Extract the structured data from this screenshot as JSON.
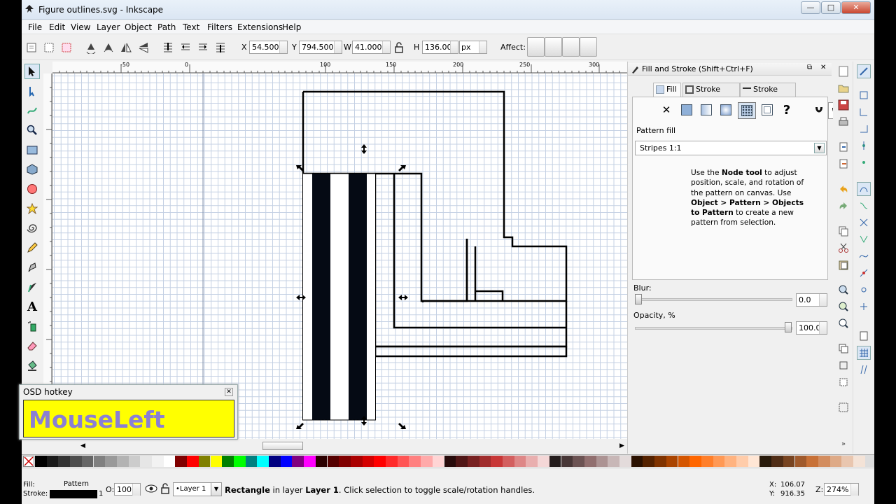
{
  "window": {
    "title": "Figure outlines.svg - Inkscape",
    "min": "—",
    "max": "□",
    "close": "✕"
  },
  "menu": [
    "File",
    "Edit",
    "View",
    "Layer",
    "Object",
    "Path",
    "Text",
    "Filters",
    "Extensions",
    "Help"
  ],
  "toolctrl": {
    "x_label": "X",
    "x_value": "54.500",
    "y_label": "Y",
    "y_value": "794.500",
    "w_label": "W",
    "w_value": "41.000",
    "h_label": "H",
    "h_value": "136.000",
    "unit": "px",
    "affect_label": "Affect:"
  },
  "ruler": {
    "top_ticks": [
      "-50",
      "0",
      "100",
      "150",
      "200",
      "250",
      "300"
    ]
  },
  "dock": {
    "title": "Fill and Stroke (Shift+Ctrl+F)",
    "tabs": [
      "Fill",
      "Stroke paint",
      "Stroke style"
    ],
    "section_label": "Pattern fill",
    "pattern_value": "Stripes 1:1",
    "help_html": "Use the <b>Node tool</b> to adjust position, scale, and rotation of the pattern on canvas. Use <b>Object &gt; Pattern &gt; Objects to Pattern</b> to create a new pattern from selection.",
    "blur_label": "Blur:",
    "blur_value": "0.0",
    "opacity_label": "Opacity, %",
    "opacity_value": "100.0",
    "fill_modes": [
      "no-paint",
      "flat",
      "linear",
      "radial",
      "pattern",
      "swatch",
      "unset"
    ],
    "unset_glyph": "?",
    "none_glyph": "✕"
  },
  "osd": {
    "title": "OSD hotkey",
    "text": "MouseLeft",
    "close": "✕",
    "bg_color": "#ffff00",
    "text_color": "#8a7fd4"
  },
  "status": {
    "fill_label": "Fill:",
    "fill_value": "Pattern",
    "stroke_label": "Stroke:",
    "stroke_width": "1",
    "opacity_label": "O:",
    "opacity_value": "100",
    "layer": "•Layer 1",
    "message_bold": "Rectangle",
    "message_mid": " in layer ",
    "message_layer": "Layer 1",
    "message_end": ". Click selection to toggle scale/rotation handles.",
    "x_label": "X:",
    "x": "106.07",
    "y_label": "Y:",
    "y": "916.35",
    "z_label": "Z:",
    "zoom": "274%"
  },
  "palette": [
    "#000000",
    "#1a1a1a",
    "#333333",
    "#4d4d4d",
    "#666666",
    "#808080",
    "#999999",
    "#b3b3b3",
    "#cccccc",
    "#e6e6e6",
    "#f2f2f2",
    "#ffffff",
    "#800000",
    "#ff0000",
    "#808000",
    "#ffff00",
    "#008000",
    "#00ff00",
    "#008080",
    "#00ffff",
    "#000080",
    "#0000ff",
    "#800080",
    "#ff00ff",
    "#2b0000",
    "#550000",
    "#800000",
    "#aa0000",
    "#d40000",
    "#ff0000",
    "#ff2a2a",
    "#ff5555",
    "#ff8080",
    "#ffaaaa",
    "#ffd5d5",
    "#280b0b",
    "#501616",
    "#782121",
    "#a02c2c",
    "#c83737",
    "#d35f5f",
    "#de8787",
    "#e9afaf",
    "#f4d7d7",
    "#241c1c",
    "#483737",
    "#6c5353",
    "#916f6f",
    "#ac9393",
    "#c8b7b7",
    "#e3dbdb",
    "#2b1100",
    "#552200",
    "#803300",
    "#aa4400",
    "#d45500",
    "#ff6600",
    "#ff7f2a",
    "#ff9955",
    "#ffb380",
    "#ffccaa",
    "#ffe6d5",
    "#281a0b",
    "#502d16",
    "#784421",
    "#a05a2c",
    "#c87137",
    "#d38d5f",
    "#deaa87",
    "#e9c6af",
    "#f4e3d7"
  ]
}
